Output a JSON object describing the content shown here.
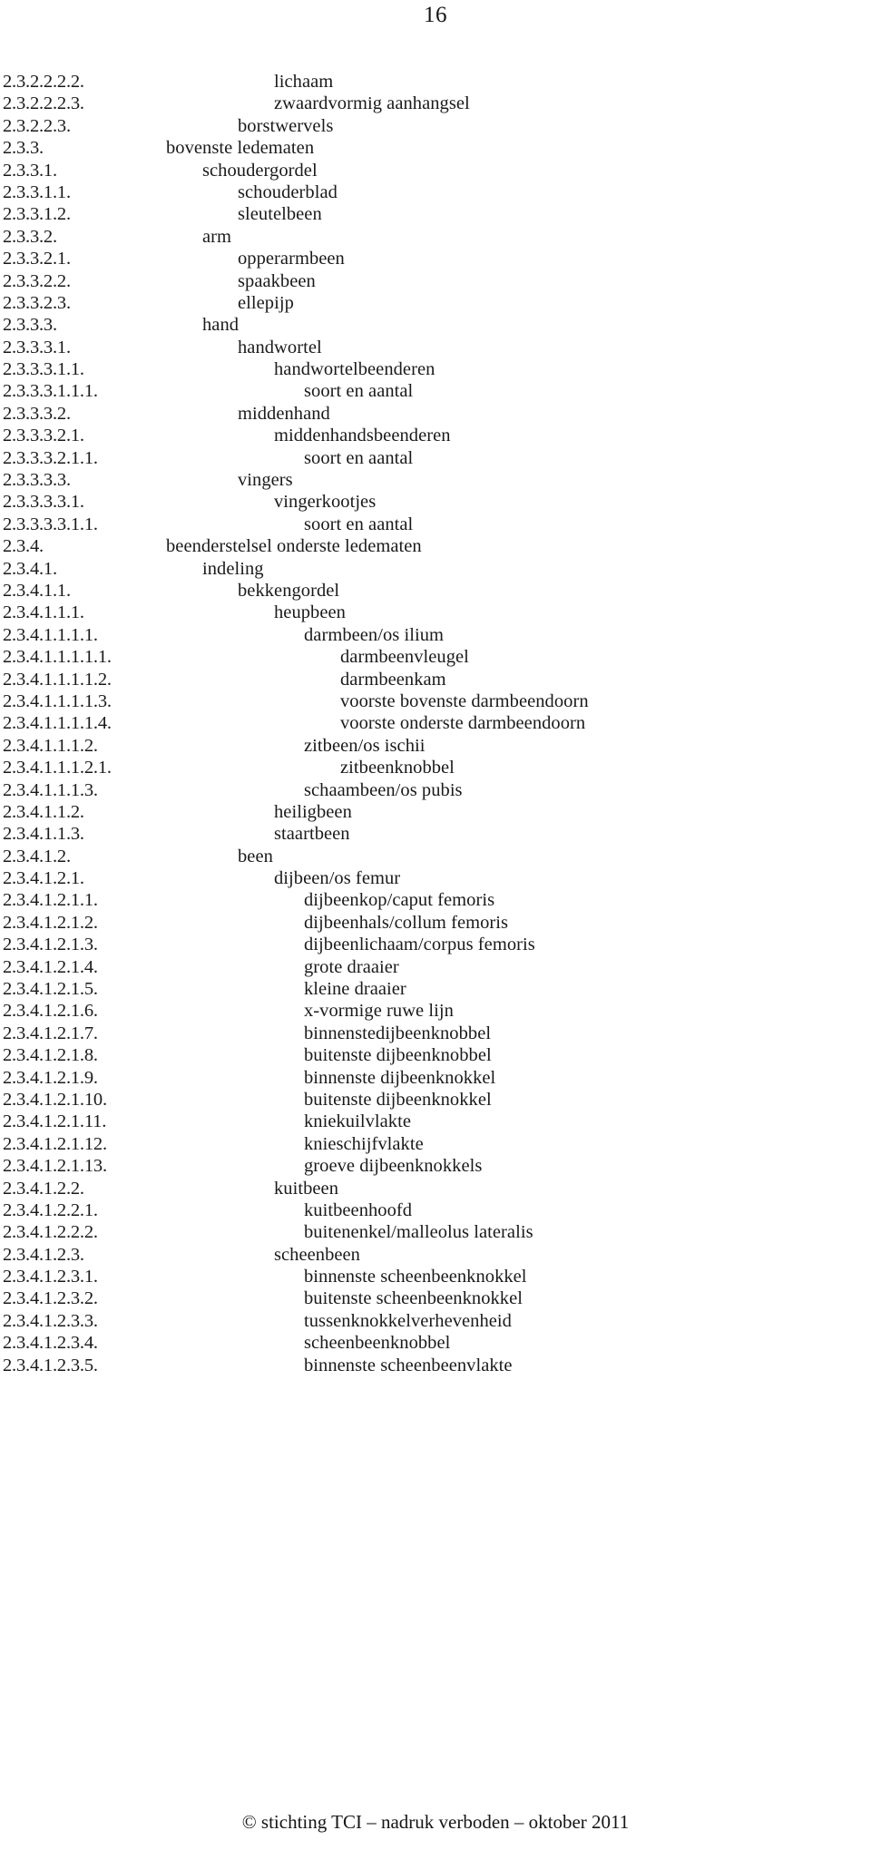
{
  "page": {
    "page_number": "16",
    "footer": "© stichting TCI – nadruk verboden – oktober 2011"
  },
  "index": {
    "rows": [
      {
        "code": "2.3.2.2.2.2.",
        "label": "lichaam",
        "depth": 6
      },
      {
        "code": "2.3.2.2.2.3.",
        "label": "zwaardvormig aanhangsel",
        "depth": 6
      },
      {
        "code": "2.3.2.2.3.",
        "label": "borstwervels",
        "depth": 5
      },
      {
        "code": "2.3.3.",
        "label": "bovenste ledematen",
        "depth": 3
      },
      {
        "code": "2.3.3.1.",
        "label": "schoudergordel",
        "depth": 4
      },
      {
        "code": "2.3.3.1.1.",
        "label": "schouderblad",
        "depth": 5
      },
      {
        "code": "2.3.3.1.2.",
        "label": "sleutelbeen",
        "depth": 5
      },
      {
        "code": "2.3.3.2.",
        "label": "arm",
        "depth": 4
      },
      {
        "code": "2.3.3.2.1.",
        "label": "opperarmbeen",
        "depth": 5
      },
      {
        "code": "2.3.3.2.2.",
        "label": "spaakbeen",
        "depth": 5
      },
      {
        "code": "2.3.3.2.3.",
        "label": "ellepijp",
        "depth": 5
      },
      {
        "code": "2.3.3.3.",
        "label": "hand",
        "depth": 4
      },
      {
        "code": "2.3.3.3.1.",
        "label": "handwortel",
        "depth": 5
      },
      {
        "code": "2.3.3.3.1.1.",
        "label": "handwortelbeenderen",
        "depth": 6
      },
      {
        "code": "2.3.3.3.1.1.1.",
        "label": "soort en aantal",
        "depth": 7
      },
      {
        "code": "2.3.3.3.2.",
        "label": "middenhand",
        "depth": 5
      },
      {
        "code": "2.3.3.3.2.1.",
        "label": "middenhandsbeenderen",
        "depth": 6
      },
      {
        "code": "2.3.3.3.2.1.1.",
        "label": "soort en aantal",
        "depth": 7
      },
      {
        "code": "2.3.3.3.3.",
        "label": "vingers",
        "depth": 5
      },
      {
        "code": "2.3.3.3.3.1.",
        "label": "vingerkootjes",
        "depth": 6
      },
      {
        "code": "2.3.3.3.3.1.1.",
        "label": "soort en aantal",
        "depth": 7
      },
      {
        "code": "2.3.4.",
        "label": "beenderstelsel onderste ledematen",
        "depth": 3
      },
      {
        "code": "2.3.4.1.",
        "label": "indeling",
        "depth": 4
      },
      {
        "code": "2.3.4.1.1.",
        "label": "bekkengordel",
        "depth": 5
      },
      {
        "code": "2.3.4.1.1.1.",
        "label": "heupbeen",
        "depth": 6
      },
      {
        "code": "2.3.4.1.1.1.1.",
        "label": "darmbeen/os ilium",
        "depth": 7
      },
      {
        "code": "2.3.4.1.1.1.1.1.",
        "label": "darmbeenvleugel",
        "depth": 8
      },
      {
        "code": "2.3.4.1.1.1.1.2.",
        "label": "darmbeenkam",
        "depth": 8
      },
      {
        "code": "2.3.4.1.1.1.1.3.",
        "label": "voorste bovenste darmbeendoorn",
        "depth": 8
      },
      {
        "code": "2.3.4.1.1.1.1.4.",
        "label": "voorste onderste darmbeendoorn",
        "depth": 8
      },
      {
        "code": "2.3.4.1.1.1.2.",
        "label": "zitbeen/os ischii",
        "depth": 7
      },
      {
        "code": "2.3.4.1.1.1.2.1.",
        "label": "zitbeenknobbel",
        "depth": 8
      },
      {
        "code": "2.3.4.1.1.1.3.",
        "label": "schaambeen/os pubis",
        "depth": 7
      },
      {
        "code": "2.3.4.1.1.2.",
        "label": "heiligbeen",
        "depth": 6
      },
      {
        "code": "2.3.4.1.1.3.",
        "label": "staartbeen",
        "depth": 6
      },
      {
        "code": "2.3.4.1.2.",
        "label": "been",
        "depth": 5
      },
      {
        "code": "2.3.4.1.2.1.",
        "label": "dijbeen/os femur",
        "depth": 6
      },
      {
        "code": "2.3.4.1.2.1.1.",
        "label": "dijbeenkop/caput femoris",
        "depth": 7
      },
      {
        "code": "2.3.4.1.2.1.2.",
        "label": "dijbeenhals/collum femoris",
        "depth": 7
      },
      {
        "code": "2.3.4.1.2.1.3.",
        "label": "dijbeenlichaam/corpus femoris",
        "depth": 7
      },
      {
        "code": "2.3.4.1.2.1.4.",
        "label": "grote draaier",
        "depth": 7
      },
      {
        "code": "2.3.4.1.2.1.5.",
        "label": "kleine draaier",
        "depth": 7
      },
      {
        "code": "2.3.4.1.2.1.6.",
        "label": "x-vormige ruwe lijn",
        "depth": 7
      },
      {
        "code": "2.3.4.1.2.1.7.",
        "label": "binnenstedijbeenknobbel",
        "depth": 7
      },
      {
        "code": "2.3.4.1.2.1.8.",
        "label": "buitenste dijbeenknobbel",
        "depth": 7
      },
      {
        "code": "2.3.4.1.2.1.9.",
        "label": "binnenste dijbeenknokkel",
        "depth": 7
      },
      {
        "code": "2.3.4.1.2.1.10.",
        "label": "buitenste dijbeenknokkel",
        "depth": 7
      },
      {
        "code": "2.3.4.1.2.1.11.",
        "label": "kniekuilvlakte",
        "depth": 7
      },
      {
        "code": "2.3.4.1.2.1.12.",
        "label": "knieschijfvlakte",
        "depth": 7
      },
      {
        "code": "2.3.4.1.2.1.13.",
        "label": "groeve dijbeenknokkels",
        "depth": 7
      },
      {
        "code": "2.3.4.1.2.2.",
        "label": "kuitbeen",
        "depth": 6
      },
      {
        "code": "2.3.4.1.2.2.1.",
        "label": "kuitbeenhoofd",
        "depth": 7
      },
      {
        "code": "2.3.4.1.2.2.2.",
        "label": "buitenenkel/malleolus lateralis",
        "depth": 7
      },
      {
        "code": "2.3.4.1.2.3.",
        "label": "scheenbeen",
        "depth": 6
      },
      {
        "code": "2.3.4.1.2.3.1.",
        "label": "binnenste scheenbeenknokkel",
        "depth": 7
      },
      {
        "code": "2.3.4.1.2.3.2.",
        "label": "buitenste scheenbeenknokkel",
        "depth": 7
      },
      {
        "code": "2.3.4.1.2.3.3.",
        "label": "tussenknokkelverhevenheid",
        "depth": 7
      },
      {
        "code": "2.3.4.1.2.3.4.",
        "label": "scheenbeenknobbel",
        "depth": 7
      },
      {
        "code": "2.3.4.1.2.3.5.",
        "label": "binnenste scheenbeenvlakte",
        "depth": 7
      }
    ]
  }
}
